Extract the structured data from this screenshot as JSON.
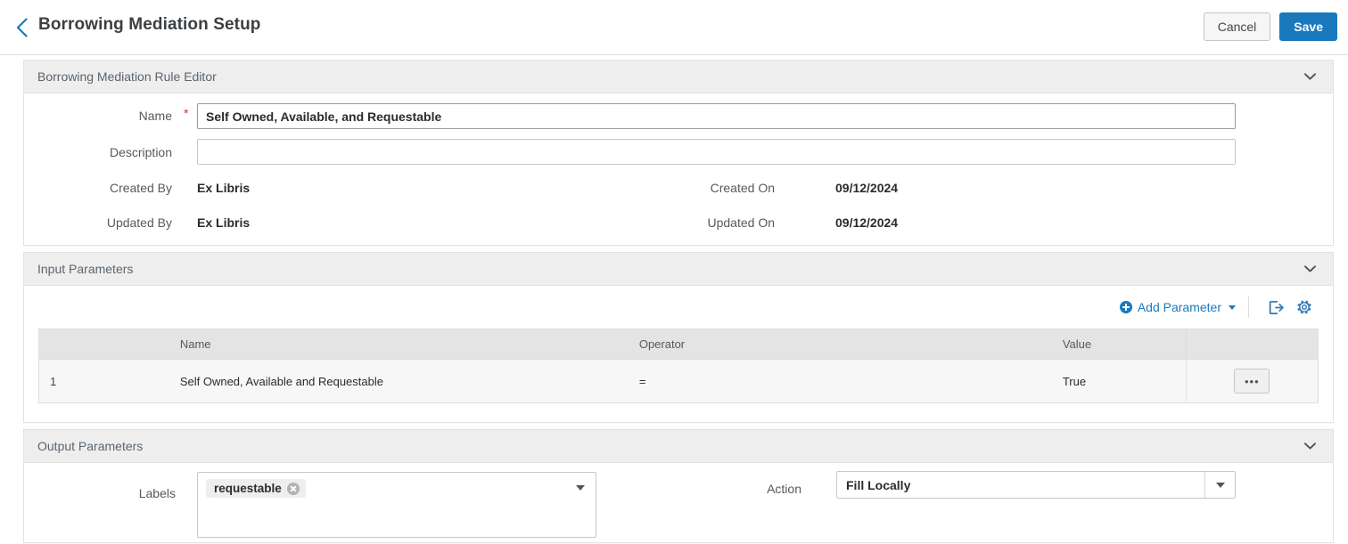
{
  "header": {
    "back_icon": "chevron-left-icon",
    "title": "Borrowing Mediation Setup",
    "cancel_label": "Cancel",
    "save_label": "Save"
  },
  "colors": {
    "accent": "#1a79bd",
    "required": "#d93025",
    "panel_header_bg": "#eeeeee",
    "table_header_bg": "#e4e4e4"
  },
  "sections": {
    "rule_editor": {
      "title": "Borrowing Mediation Rule Editor",
      "fields": {
        "name_label": "Name",
        "name_required_marker": "*",
        "name_value": "Self Owned, Available, and Requestable",
        "description_label": "Description",
        "description_value": "",
        "description_placeholder": "",
        "created_by_label": "Created By",
        "created_by_value": "Ex Libris",
        "created_on_label": "Created On",
        "created_on_value": "09/12/2024",
        "updated_by_label": "Updated By",
        "updated_by_value": "Ex Libris",
        "updated_on_label": "Updated On",
        "updated_on_value": "09/12/2024"
      }
    },
    "input_parameters": {
      "title": "Input Parameters",
      "toolbar": {
        "add_parameter_label": "Add Parameter",
        "add_icon": "plus-circle-icon",
        "dropdown_icon": "caret-down-icon",
        "export_icon": "export-icon",
        "settings_icon": "gear-icon"
      },
      "table": {
        "columns": [
          "",
          "Name",
          "Operator",
          "Value",
          ""
        ],
        "rows": [
          {
            "index": "1",
            "name": "Self Owned, Available and Requestable",
            "operator": "=",
            "value": "True",
            "actions_label": "•••"
          }
        ]
      }
    },
    "output_parameters": {
      "title": "Output Parameters",
      "labels_label": "Labels",
      "labels_chips": [
        "requestable"
      ],
      "labels_caret_icon": "caret-down-icon",
      "action_label": "Action",
      "action_value": "Fill Locally",
      "action_caret_icon": "caret-down-icon"
    }
  }
}
